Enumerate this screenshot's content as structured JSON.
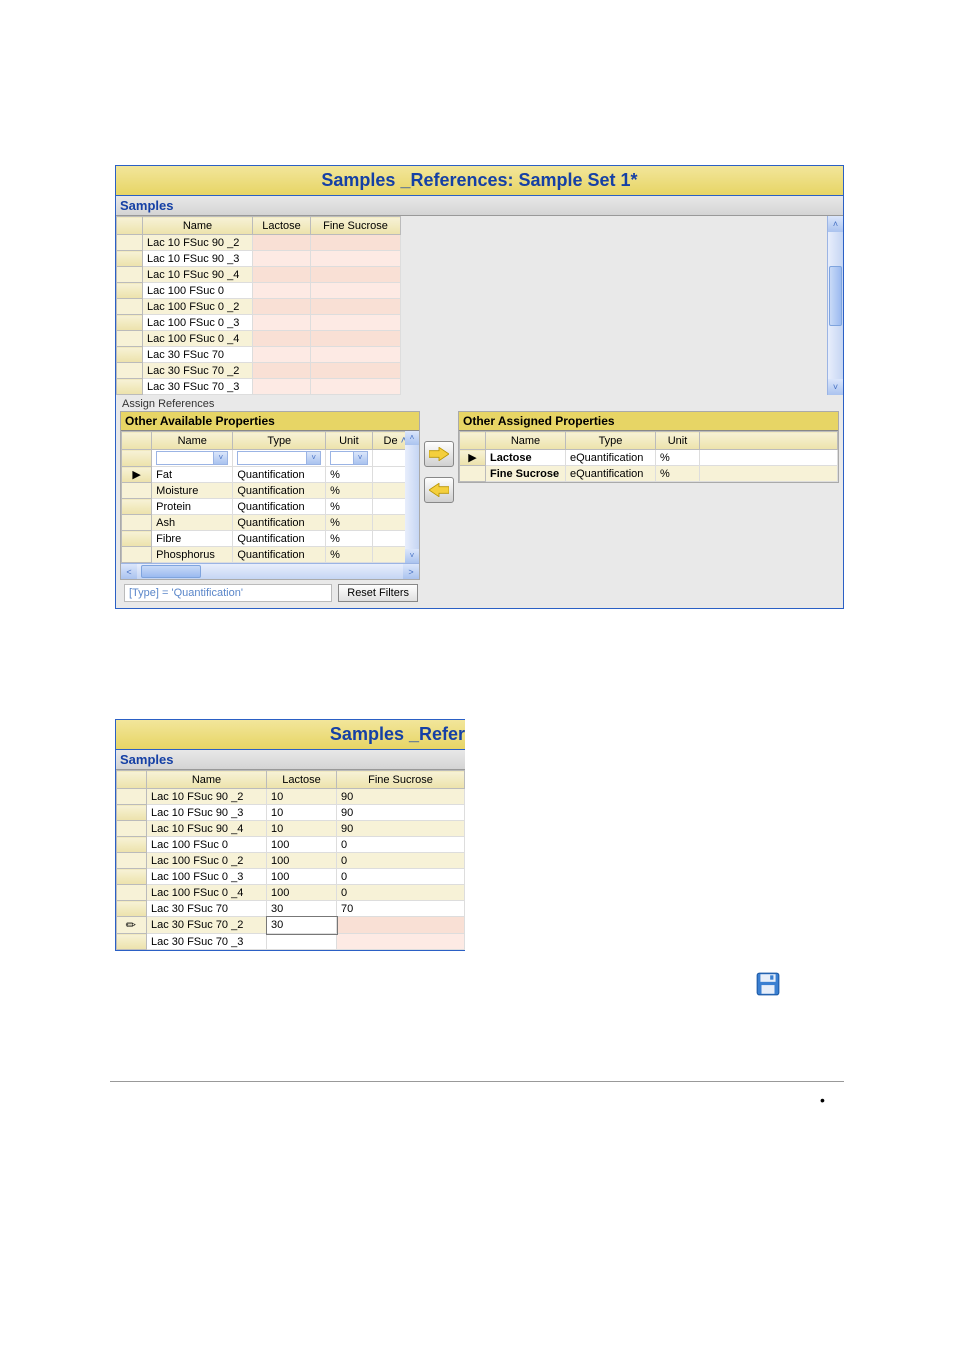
{
  "title1": "Samples _References: Sample Set 1*",
  "title2": "Samples _Refer",
  "samples_header": "Samples",
  "assign_refs_label": "Assign References",
  "available_title": "Other Available Properties",
  "assigned_title": "Other Assigned Properties",
  "filter_text": "[Type] = 'Quantification'",
  "reset_filters": "Reset Filters",
  "cols": {
    "name": "Name",
    "lactose": "Lactose",
    "fine_sucrose": "Fine Sucrose"
  },
  "prop_cols": {
    "name": "Name",
    "type": "Type",
    "unit": "Unit",
    "de": "De"
  },
  "samples1": [
    {
      "name": "Lac 10 FSuc 90 _2"
    },
    {
      "name": "Lac 10 FSuc 90 _3"
    },
    {
      "name": "Lac 10 FSuc 90 _4"
    },
    {
      "name": "Lac 100 FSuc 0"
    },
    {
      "name": "Lac 100 FSuc 0 _2"
    },
    {
      "name": "Lac 100 FSuc 0 _3"
    },
    {
      "name": "Lac 100 FSuc 0 _4"
    },
    {
      "name": "Lac 30 FSuc 70"
    },
    {
      "name": "Lac 30 FSuc 70 _2"
    },
    {
      "name": "Lac 30 FSuc 70 _3"
    }
  ],
  "available_props": [
    {
      "name": "Fat",
      "type": "Quantification",
      "unit": "%",
      "marker": "▶"
    },
    {
      "name": "Moisture",
      "type": "Quantification",
      "unit": "%"
    },
    {
      "name": "Protein",
      "type": "Quantification",
      "unit": "%"
    },
    {
      "name": "Ash",
      "type": "Quantification",
      "unit": "%"
    },
    {
      "name": "Fibre",
      "type": "Quantification",
      "unit": "%"
    },
    {
      "name": "Phosphorus",
      "type": "Quantification",
      "unit": "%"
    }
  ],
  "assigned_props": [
    {
      "name": "Lactose",
      "type": "eQuantification",
      "unit": "%",
      "marker": "▶"
    },
    {
      "name": "Fine Sucrose",
      "type": "eQuantification",
      "unit": "%"
    }
  ],
  "samples2": [
    {
      "name": "Lac 10 FSuc 90 _2",
      "lactose": "10",
      "fs": "90"
    },
    {
      "name": "Lac 10 FSuc 90 _3",
      "lactose": "10",
      "fs": "90"
    },
    {
      "name": "Lac 10 FSuc 90 _4",
      "lactose": "10",
      "fs": "90"
    },
    {
      "name": "Lac 100 FSuc 0",
      "lactose": "100",
      "fs": "0"
    },
    {
      "name": "Lac 100 FSuc 0 _2",
      "lactose": "100",
      "fs": "0"
    },
    {
      "name": "Lac 100 FSuc 0 _3",
      "lactose": "100",
      "fs": "0"
    },
    {
      "name": "Lac 100 FSuc 0 _4",
      "lactose": "100",
      "fs": "0"
    },
    {
      "name": "Lac 30 FSuc 70",
      "lactose": "30",
      "fs": "70"
    },
    {
      "name": "Lac 30 FSuc 70 _2",
      "lactose": "30",
      "fs": "",
      "editing": true
    },
    {
      "name": "Lac 30 FSuc 70 _3",
      "lactose": "",
      "fs": ""
    }
  ]
}
